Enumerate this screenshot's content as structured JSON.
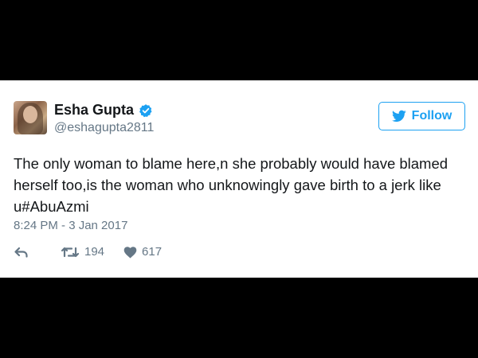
{
  "user": {
    "name": "Esha Gupta",
    "handle": "@eshagupta2811"
  },
  "follow": {
    "label": "Follow"
  },
  "tweet": {
    "text": "The only woman to blame here,n she probably would have blamed\nherself too,is the woman who unknowingly gave birth to a jerk like\nu#AbuAzmi",
    "timestamp": "8:24 PM - 3 Jan 2017",
    "retweets": "194",
    "likes": "617"
  },
  "icons": {
    "verified": "verified-badge-icon",
    "follow": "twitter-bird-icon",
    "reply": "reply-icon",
    "retweet": "retweet-icon",
    "like": "heart-icon"
  },
  "colors": {
    "accent": "#1da1f2",
    "text": "#14171a",
    "muted": "#657786",
    "frame": "#000000"
  }
}
